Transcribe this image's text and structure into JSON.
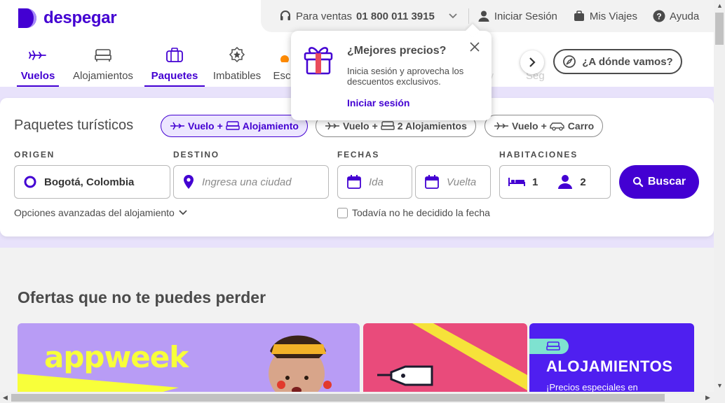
{
  "brand": {
    "name": "despegar",
    "color": "#4300d2"
  },
  "topbar": {
    "sales_label": "Para ventas",
    "sales_phone": "01 800 011 3915",
    "login": "Iniciar Sesión",
    "trips": "Mis Viajes",
    "help": "Ayuda"
  },
  "nav": {
    "items": [
      {
        "label": "Vuelos",
        "icon": "plane-icon"
      },
      {
        "label": "Alojamientos",
        "icon": "bed-icon"
      },
      {
        "label": "Paquetes",
        "icon": "suitcase-icon"
      },
      {
        "label": "Imbatibles",
        "icon": "badge-star-icon"
      },
      {
        "label": "Esc",
        "icon": "getaway-icon"
      },
      {
        "label": "ney",
        "icon": "money-icon"
      },
      {
        "label": "Seg",
        "icon": "insurance-icon"
      }
    ],
    "where_label": "¿A dónde vamos?"
  },
  "popover": {
    "title": "¿Mejores precios?",
    "body": "Inicia sesión y aprovecha los descuentos exclusivos.",
    "link": "Iniciar sesión"
  },
  "search": {
    "title": "Paquetes turísticos",
    "chips": [
      {
        "p1": "Vuelo",
        "plus": "+",
        "p2": "Alojamiento"
      },
      {
        "p1": "Vuelo",
        "plus": "+",
        "p2": "2 Alojamientos"
      },
      {
        "p1": "Vuelo",
        "plus": "+",
        "p2": "Carro"
      }
    ],
    "origin_label": "ORIGEN",
    "origin_value": "Bogotá, Colombia",
    "destination_label": "DESTINO",
    "destination_placeholder": "Ingresa una ciudad",
    "dates_label": "FECHAS",
    "depart_placeholder": "Ida",
    "return_placeholder": "Vuelta",
    "rooms_label": "HABITACIONES",
    "rooms_value": "1",
    "people_value": "2",
    "search_button": "Buscar",
    "advanced": "Opciones avanzadas del alojamiento",
    "undecided": "Todavía no he decidido la fecha"
  },
  "offers": {
    "title": "Ofertas que no te puedes perder",
    "banner1_text": "appweek",
    "banner3_title": "ALOJAMIENTOS",
    "banner3_sub": "¡Precios especiales en"
  }
}
